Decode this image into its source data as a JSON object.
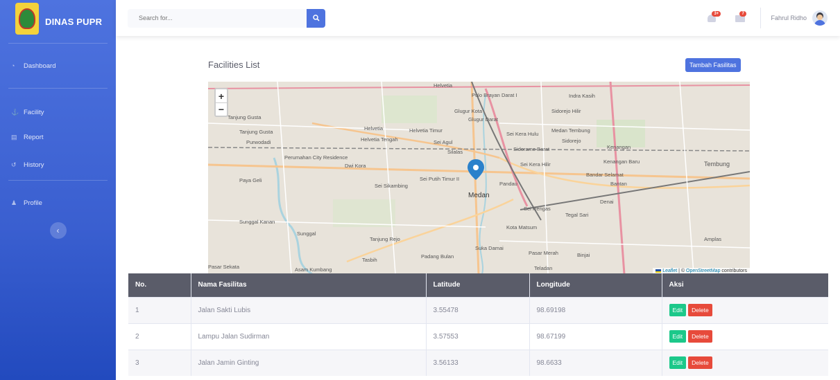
{
  "sidebar": {
    "brand": "DINAS PUPR",
    "items": [
      {
        "label": "Dashboard",
        "icon": "tachometer-icon"
      },
      {
        "label": "Facility",
        "icon": "anchor-icon"
      },
      {
        "label": "Report",
        "icon": "report-icon"
      },
      {
        "label": "History",
        "icon": "history-icon"
      },
      {
        "label": "Profile",
        "icon": "user-icon"
      }
    ],
    "toggle_icon": "chevron-left-icon"
  },
  "topbar": {
    "search_placeholder": "Search for...",
    "alerts_badge": "3+",
    "messages_badge": "7",
    "user_name": "Fahrul Ridho"
  },
  "page": {
    "title": "Facilities List",
    "add_button": "Tambah Fasilitas"
  },
  "map": {
    "labels": {
      "helvetia": "Helvetia",
      "pulo_brayan": "Pulo Brayan Darat I",
      "indra_kasih": "Indra Kasih",
      "tanjung_gusta": "Tanjung Gusta",
      "glugur_kota": "Glugur Kota",
      "glugur_darat": "Glugur Darat",
      "sidorejo_hilir": "Sidorejo Hilir",
      "helvetia_timur": "Helvetia Timur",
      "sei_kera_hulu": "Sei Kera Hulu",
      "medan_tembung": "Medan Tembung",
      "helvetia_tengah": "Helvetia Tengah",
      "sei_agul": "Sei Agul",
      "sidorejo": "Sidorejo",
      "kenangan": "Kenangan",
      "purwodadi": "Purwodadi",
      "silalas": "Silalas",
      "sidorame_barat": "Sidorame Barat",
      "perumahan": "Perumahan City Residence",
      "dwi_kora": "Dwi Kora",
      "sei_kera_hilir": "Sei Kera Hilir",
      "kenangan_baru": "Kenangan Baru",
      "tembung": "Tembung",
      "paya_geli": "Paya Geli",
      "sei_putih_timur": "Sei Putih Timur II",
      "bandar_selamat": "Bandar Selamat",
      "sei_sikambing": "Sei Sikambing",
      "pandau": "Pandau",
      "bantan": "Bantan",
      "medan": "Medan",
      "denai": "Denai",
      "sei_rengas": "Sei Rengas",
      "tegal_sari": "Tegal Sari",
      "sunggal_kanan": "Sunggal Kanan",
      "sunggal": "Sunggal",
      "kota_matsum": "Kota Matsum",
      "tanjung_rejo": "Tanjung Rejo",
      "suka_damai": "Suka Damai",
      "amplas": "Amplas",
      "pasar_merah": "Pasar Merah",
      "binjai": "Binjai",
      "padang_bulan": "Padang Bulan",
      "tasbih": "Tasbih",
      "teladan": "Teladan",
      "pasar_sekata": "Pasar Sekata",
      "asam_kumbang": "Asam Kumbang"
    },
    "attribution_leaflet": "Leaflet",
    "attribution_sep": " | © ",
    "attribution_osm": "OpenStreetMap",
    "attribution_rest": " contributors"
  },
  "table": {
    "headers": [
      "No.",
      "Nama Fasilitas",
      "Latitude",
      "Longitude",
      "Aksi"
    ],
    "rows": [
      {
        "no": "1",
        "name": "Jalan Sakti Lubis",
        "lat": "3.55478",
        "lng": "98.69198"
      },
      {
        "no": "2",
        "name": "Lampu Jalan Sudirman",
        "lat": "3.57553",
        "lng": "98.67199"
      },
      {
        "no": "3",
        "name": "Jalan Jamin Ginting",
        "lat": "3.56133",
        "lng": "98.6633"
      }
    ],
    "edit_label": "Edit",
    "delete_label": "Delete"
  },
  "colors": {
    "primary": "#4e73df",
    "success": "#1cc88a",
    "danger": "#e74a3b",
    "table_header": "#5a5c69"
  }
}
